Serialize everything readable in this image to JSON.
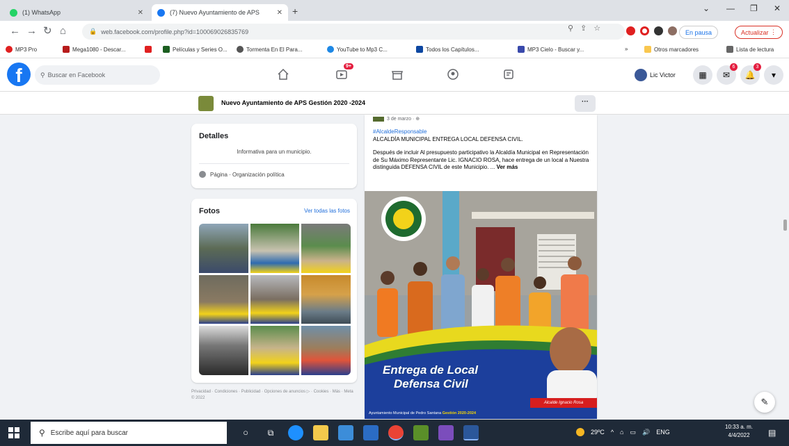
{
  "browser": {
    "tabs": [
      {
        "title": "(1) WhatsApp",
        "favicon_color": "#25d366"
      },
      {
        "title": "(7) Nuevo Ayuntamiento de APS ",
        "favicon_color": "#1877f2"
      }
    ],
    "url": "web.facebook.com/profile.php?id=100069026835769",
    "profile_pill": "En pausa",
    "update_pill": "Actualizar",
    "bookmarks": [
      {
        "label": "MP3 Pro",
        "color": "#e02020"
      },
      {
        "label": "Mega1080 - Descar...",
        "color": "#b71c1c"
      },
      {
        "label": "Películas y Series O...",
        "color": "#1b5e20"
      },
      {
        "label": "Tormenta En El Para...",
        "color": "#555555"
      },
      {
        "label": "YouTube to Mp3 C...",
        "color": "#1e88e5"
      },
      {
        "label": "Todos los Capítulos...",
        "color": "#0d47a1"
      },
      {
        "label": "MP3 Cielo - Buscar y...",
        "color": "#3949ab"
      },
      {
        "label": "Otros marcadores",
        "color": "#f9c74f"
      },
      {
        "label": "Lista de lectura",
        "color": "#666666"
      }
    ]
  },
  "fb": {
    "search_placeholder": "Buscar en Facebook",
    "video_badge": "9+",
    "profile_name": "Lic Victor",
    "messenger_badge": "6",
    "notif_badge": "3"
  },
  "page": {
    "name": "Nuevo Ayuntamiento de APS Gestión 2020 -2024",
    "more_label": "···"
  },
  "details": {
    "title": "Detalles",
    "description": "Informativa para un municipio.",
    "page_type": "Página · Organización política"
  },
  "photos": {
    "title": "Fotos",
    "see_all": "Ver todas las fotos"
  },
  "footer_text": "Privacidad · Condiciones · Publicidad · Opciones de anuncios ▷ · Cookies · Más · Meta © 2022",
  "post": {
    "date": "3 de marzo · ⊕",
    "hashtag": "#AlcaldeResponsable",
    "headline": "ALCALDÍA MUNICIPAL ENTREGA LOCAL  DEFENSA CIVIL.",
    "body": "Después de incluir Al presupuesto participativo la Alcaldía Municipal en Representación de Su Máximo Representante Lic. IGNACIO ROSA, hace entrega de un local  a Nuestra distinguida DEFENSA CIVIL de este Municipio. ... ",
    "see_more": "Ver más",
    "banner_line1": "Entrega de Local",
    "banner_line2": "Defensa Civil",
    "name_tag": "Alcalde Ignacio Rosa",
    "bottom_text": "Ayuntamiento Municipal de Pedro Santana",
    "bottom_year": "Gestión 2020-2024"
  },
  "taskbar": {
    "search_placeholder": "Escribe aquí para buscar",
    "weather": "29ºC",
    "lang": "ENG",
    "time": "10:33 a. m.",
    "date": "4/4/2022"
  }
}
